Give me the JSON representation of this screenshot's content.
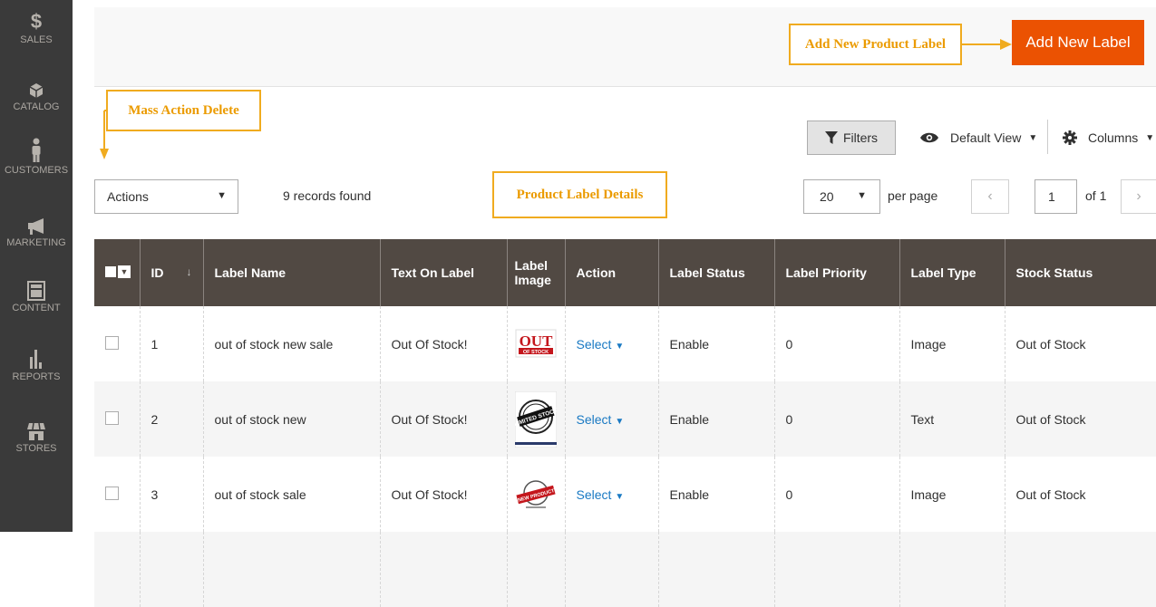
{
  "sidebar": {
    "items": [
      {
        "label": "SALES",
        "icon": "dollar-icon",
        "glyph": "$"
      },
      {
        "label": "CATALOG",
        "icon": "box-icon"
      },
      {
        "label": "CUSTOMERS",
        "icon": "person-icon"
      },
      {
        "label": "MARKETING",
        "icon": "megaphone-icon"
      },
      {
        "label": "CONTENT",
        "icon": "layout-icon"
      },
      {
        "label": "REPORTS",
        "icon": "bar-chart-icon"
      },
      {
        "label": "STORES",
        "icon": "storefront-icon"
      }
    ]
  },
  "header": {
    "add_button_label": "Add New Label"
  },
  "callouts": {
    "add_new_product_label": "Add New Product Label",
    "mass_action_delete": "Mass Action Delete",
    "product_label_details": "Product Label Details"
  },
  "toolbar": {
    "filters_label": "Filters",
    "view_label": "Default View",
    "columns_label": "Columns",
    "actions_value": "Actions",
    "records_found": "9 records found",
    "per_page_value": "20",
    "per_page_label": "per page",
    "page_value": "1",
    "of_pages": "of 1",
    "prev_glyph": "‹",
    "next_glyph": "›"
  },
  "table": {
    "columns": [
      "ID",
      "Label Name",
      "Text On Label",
      "Label Image",
      "Action",
      "Label Status",
      "Label Priority",
      "Label Type",
      "Stock Status"
    ],
    "rows": [
      {
        "id": "1",
        "name": "out of stock new sale",
        "text": "Out Of Stock!",
        "image_text": "OUT OF STOCK",
        "action": "Select",
        "status": "Enable",
        "priority": "0",
        "type": "Image",
        "stock": "Out of Stock"
      },
      {
        "id": "2",
        "name": "out of stock new",
        "text": "Out Of Stock!",
        "image_text": "LIMITED STOCK",
        "action": "Select",
        "status": "Enable",
        "priority": "0",
        "type": "Text",
        "stock": "Out of Stock"
      },
      {
        "id": "3",
        "name": "out of stock sale",
        "text": "Out Of Stock!",
        "image_text": "NEW PRODUCT",
        "action": "Select",
        "status": "Enable",
        "priority": "0",
        "type": "Image",
        "stock": "Out of Stock"
      }
    ]
  },
  "colors": {
    "sidebar_bg": "#3a3a3a",
    "primary_button": "#eb5202",
    "callout": "#f0ab1f",
    "table_header": "#514943",
    "link": "#1979c3"
  }
}
